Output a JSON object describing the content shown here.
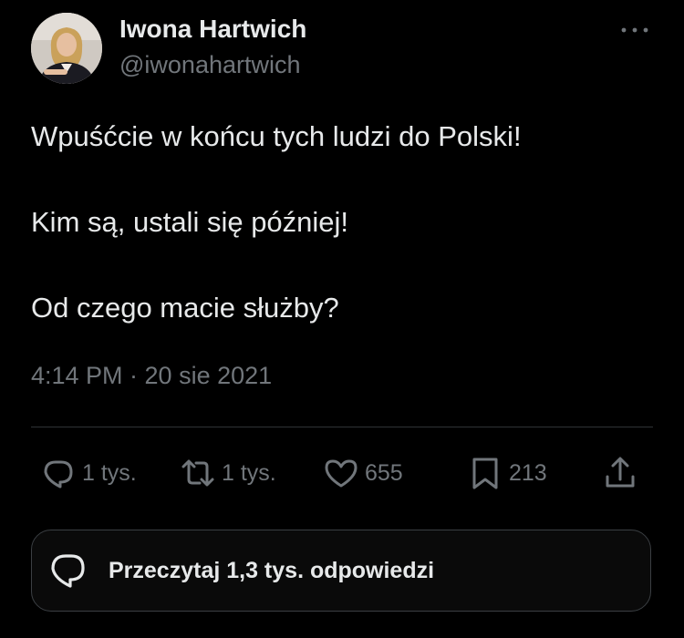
{
  "author": {
    "display_name": "Iwona Hartwich",
    "handle": "@iwonahartwich"
  },
  "tweet": {
    "lines": [
      "Wpuśćcie w końcu tych ludzi do Polski!",
      "Kim są, ustali się później!",
      "Od czego macie służby?"
    ],
    "timestamp": "4:14 PM · 20 sie 2021"
  },
  "actions": {
    "reply_count": "1 tys.",
    "repost_count": "1 tys.",
    "like_count": "655",
    "bookmark_count": "213"
  },
  "replies_button": {
    "label": "Przeczytaj 1,3 tys. odpowiedzi"
  },
  "icons": {
    "more": "more-horizontal-icon",
    "reply": "reply-bubble-icon",
    "repost": "repost-icon",
    "like": "heart-icon",
    "bookmark": "bookmark-icon",
    "share": "share-upload-icon",
    "replies": "chat-bubble-icon"
  },
  "colors": {
    "background": "#000000",
    "primary_text": "#e7e9ea",
    "secondary_text": "#71767b",
    "divider": "#2f3336"
  }
}
